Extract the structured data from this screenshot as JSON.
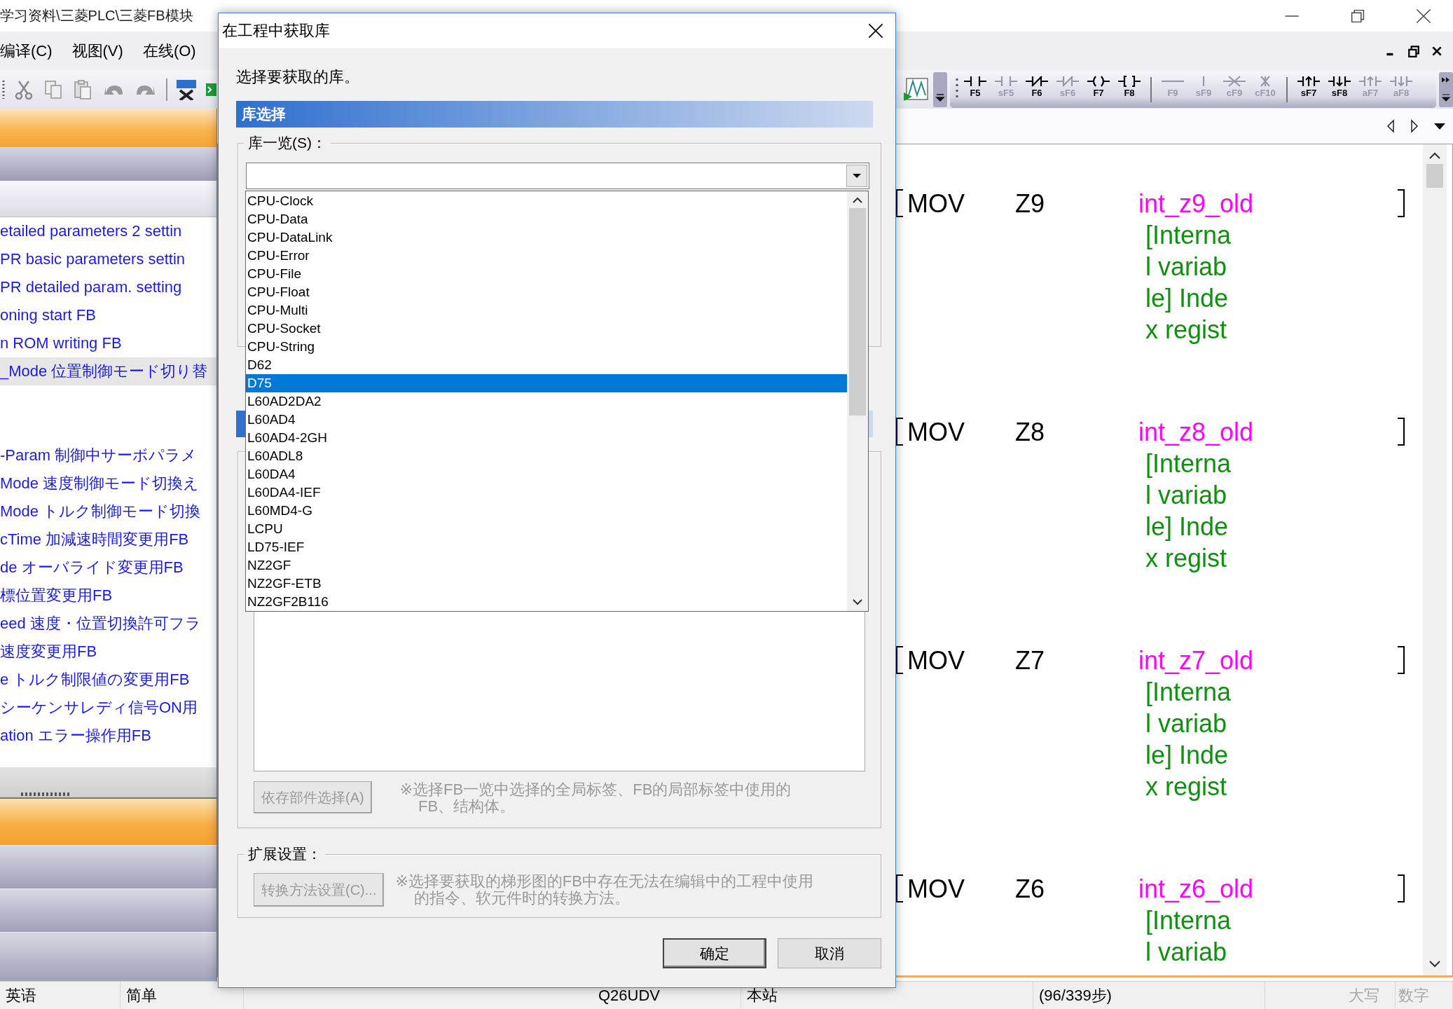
{
  "main_window": {
    "title": "学习资料\\三菱PLC\\三菱FB模块",
    "menu": [
      {
        "label": "编译(C)"
      },
      {
        "label": "视图(V)"
      },
      {
        "label": "在线(O)"
      }
    ]
  },
  "toolbar": {
    "fkeys": [
      {
        "kind": "contact-open",
        "label": "F5",
        "disabled": false
      },
      {
        "kind": "contact-open",
        "label": "sF5",
        "disabled": true
      },
      {
        "kind": "contact-closed",
        "label": "F6",
        "disabled": false
      },
      {
        "kind": "contact-closed",
        "label": "sF6",
        "disabled": true
      },
      {
        "kind": "coil",
        "label": "F7",
        "disabled": false
      },
      {
        "kind": "function",
        "label": "F8",
        "disabled": false
      },
      {
        "kind": "separator"
      },
      {
        "kind": "hline",
        "label": "F9",
        "disabled": true
      },
      {
        "kind": "vline",
        "label": "sF9",
        "disabled": true
      },
      {
        "kind": "hdelete",
        "label": "cF9",
        "disabled": true
      },
      {
        "kind": "vdelete",
        "label": "cF10",
        "disabled": true
      },
      {
        "kind": "separator"
      },
      {
        "kind": "rise",
        "label": "sF7",
        "disabled": false
      },
      {
        "kind": "fall",
        "label": "sF8",
        "disabled": false
      },
      {
        "kind": "rise",
        "label": "aF7",
        "disabled": true
      },
      {
        "kind": "fall",
        "label": "aF8",
        "disabled": true
      }
    ]
  },
  "left_panel": {
    "items": [
      {
        "label": "etailed parameters 2 settin",
        "selected": false
      },
      {
        "label": "PR basic parameters settin",
        "selected": false
      },
      {
        "label": "PR detailed param. setting",
        "selected": false
      },
      {
        "label": "oning start FB",
        "selected": false
      },
      {
        "label": "n ROM writing FB",
        "selected": false
      },
      {
        "label": "_Mode 位置制御モード切り替",
        "selected": true
      },
      {
        "label": "-Param 制御中サーボパラメ",
        "selected": false
      },
      {
        "label": "Mode 速度制御モード切換え",
        "selected": false
      },
      {
        "label": "Mode トルク制御モード切換",
        "selected": false
      },
      {
        "label": "cTime 加減速時間変更用FB",
        "selected": false
      },
      {
        "label": "de オーバライド変更用FB",
        "selected": false
      },
      {
        "label": "標位置変更用FB",
        "selected": false
      },
      {
        "label": "eed 速度・位置切換許可フラ",
        "selected": false
      },
      {
        "label": "速度変更用FB",
        "selected": false
      },
      {
        "label": "e トルク制限値の変更用FB",
        "selected": false
      },
      {
        "label": "シーケンサレディ信号ON用",
        "selected": false
      },
      {
        "label": "ation エラー操作用FB",
        "selected": false
      }
    ]
  },
  "ladder": {
    "rungs": [
      {
        "instruction": "MOV",
        "operand": "Z9",
        "label": "int_z9_old",
        "comment": [
          "[Interna",
          "l variab",
          "le] Inde",
          "x regist"
        ]
      },
      {
        "instruction": "MOV",
        "operand": "Z8",
        "label": "int_z8_old",
        "comment": [
          "[Interna",
          "l variab",
          "le] Inde",
          "x regist"
        ]
      },
      {
        "instruction": "MOV",
        "operand": "Z7",
        "label": "int_z7_old",
        "comment": [
          "[Interna",
          "l variab",
          "le] Inde",
          "x regist"
        ]
      },
      {
        "instruction": "MOV",
        "operand": "Z6",
        "label": "int_z6_old",
        "comment": [
          "[Interna",
          "l variab"
        ]
      }
    ]
  },
  "status_bar": [
    {
      "text": "英语",
      "disabled": false
    },
    {
      "text": "简单",
      "disabled": false
    },
    {
      "text": "Q26UDV",
      "disabled": false
    },
    {
      "text": "本站",
      "disabled": false
    },
    {
      "text": "(96/339步)",
      "disabled": false
    },
    {
      "text": "大写",
      "disabled": true
    },
    {
      "text": "数字",
      "disabled": true
    }
  ],
  "dialog": {
    "title": "在工程中获取库",
    "prompt": "选择要获取的库。",
    "section": "库选择",
    "group_label": "库一览(S)：",
    "dropdown": {
      "items": [
        {
          "label": "CPU-Clock",
          "selected": false
        },
        {
          "label": "CPU-Data",
          "selected": false
        },
        {
          "label": "CPU-DataLink",
          "selected": false
        },
        {
          "label": "CPU-Error",
          "selected": false
        },
        {
          "label": "CPU-File",
          "selected": false
        },
        {
          "label": "CPU-Float",
          "selected": false
        },
        {
          "label": "CPU-Multi",
          "selected": false
        },
        {
          "label": "CPU-Socket",
          "selected": false
        },
        {
          "label": "CPU-String",
          "selected": false
        },
        {
          "label": "D62",
          "selected": false
        },
        {
          "label": "D75",
          "selected": true
        },
        {
          "label": "L60AD2DA2",
          "selected": false
        },
        {
          "label": "L60AD4",
          "selected": false
        },
        {
          "label": "L60AD4-2GH",
          "selected": false
        },
        {
          "label": "L60ADL8",
          "selected": false
        },
        {
          "label": "L60DA4",
          "selected": false
        },
        {
          "label": "L60DA4-IEF",
          "selected": false
        },
        {
          "label": "L60MD4-G",
          "selected": false
        },
        {
          "label": "LCPU",
          "selected": false
        },
        {
          "label": "LD75-IEF",
          "selected": false
        },
        {
          "label": "NZ2GF",
          "selected": false
        },
        {
          "label": "NZ2GF-ETB",
          "selected": false
        },
        {
          "label": "NZ2GF2B116",
          "selected": false
        }
      ]
    },
    "dependency_button": {
      "label": "依存部件选择(A)",
      "disabled": true
    },
    "dependency_note": {
      "text": "※选择FB一览中选择的全局标签、FB的局部标签中使用的FB、结构体。",
      "disabled": true
    },
    "extension_group": {
      "label": "扩展设置：",
      "button": {
        "label": "转换方法设置(C)...",
        "disabled": true
      },
      "note": {
        "text": "※选择要获取的梯形图的FB中存在无法在编辑中的工程中使用的指令、软元件时的转换方法。",
        "disabled": true
      }
    },
    "buttons": [
      {
        "label": "确定",
        "default": true
      },
      {
        "label": "取消",
        "default": false
      }
    ]
  }
}
